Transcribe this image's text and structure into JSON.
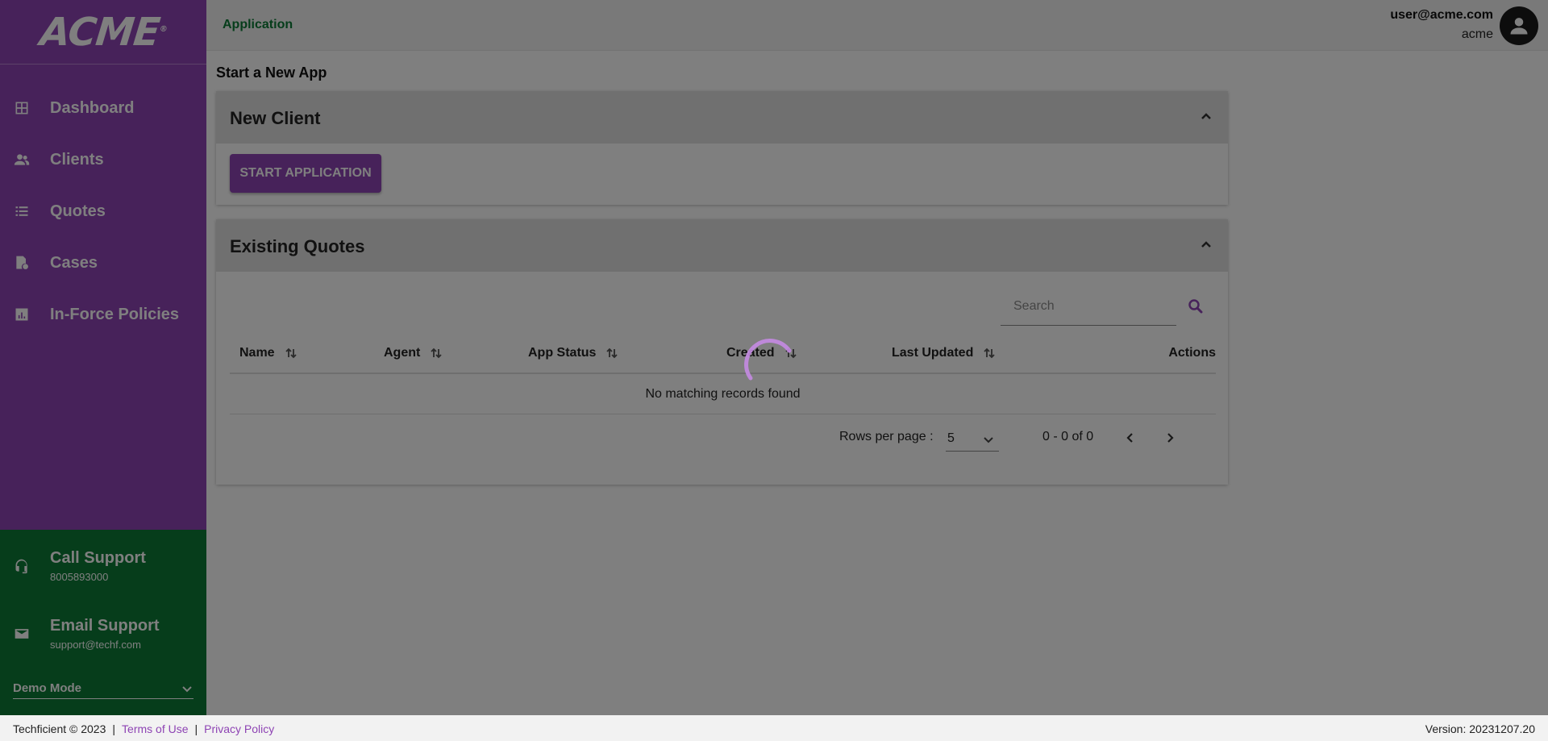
{
  "brand": {
    "logo_text": "ACME",
    "primary_color": "#8e44b4",
    "support_color": "#0c7a36"
  },
  "sidebar": {
    "items": [
      {
        "label": "Dashboard",
        "icon": "dashboard-icon"
      },
      {
        "label": "Clients",
        "icon": "people-icon"
      },
      {
        "label": "Quotes",
        "icon": "list-icon"
      },
      {
        "label": "Cases",
        "icon": "case-icon"
      },
      {
        "label": "In-Force Policies",
        "icon": "bar-chart-icon"
      }
    ],
    "support": {
      "call_title": "Call Support",
      "call_number": "8005893000",
      "email_title": "Email Support",
      "email_address": "support@techf.com"
    },
    "mode_select": "Demo Mode"
  },
  "header": {
    "breadcrumb": "Application",
    "user_email": "user@acme.com",
    "user_org": "acme"
  },
  "main": {
    "page_title": "Start a New App",
    "new_client": {
      "title": "New Client",
      "button_label": "START APPLICATION"
    },
    "existing_quotes": {
      "title": "Existing Quotes",
      "search_placeholder": "Search",
      "columns": [
        "Name",
        "Agent",
        "App Status",
        "Created",
        "Last Updated",
        "Actions"
      ],
      "empty_message": "No matching records found",
      "rows_per_page_label": "Rows per page :",
      "rows_per_page_value": "5",
      "range_text": "0 - 0 of 0"
    }
  },
  "footer": {
    "copyright": "Techficient © 2023",
    "terms": "Terms of Use",
    "privacy": "Privacy Policy",
    "version": "Version: 20231207.20"
  }
}
